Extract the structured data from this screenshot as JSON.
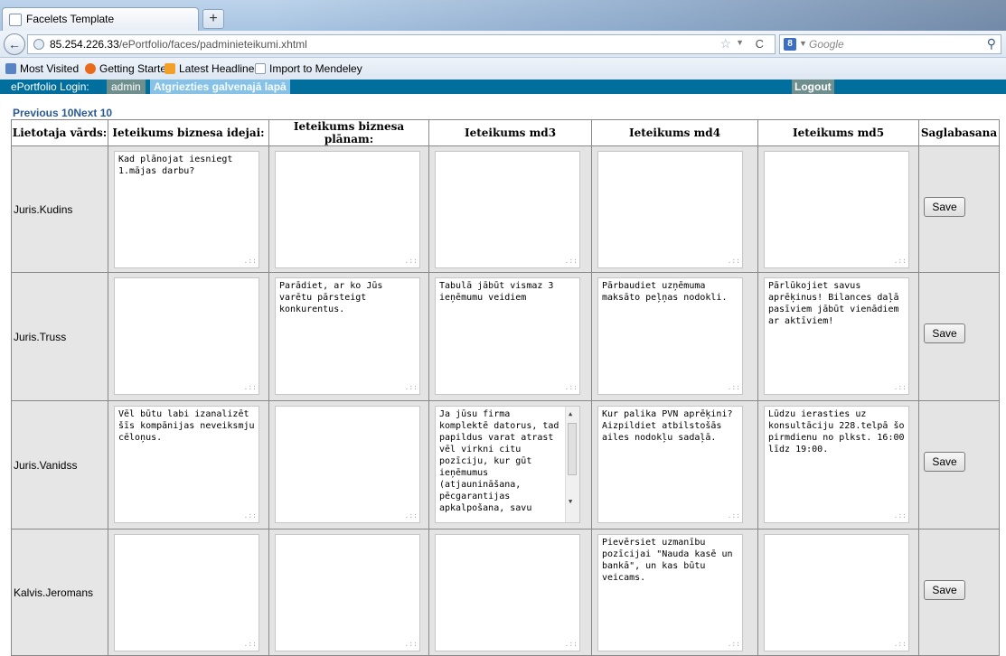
{
  "browser": {
    "tab_title": "Facelets Template",
    "new_tab": "+",
    "url_host": "85.254.226.33",
    "url_path": "/ePortfolio/faces/padminieteikumi.xhtml",
    "search_placeholder": "Google",
    "bookmarks": [
      {
        "label": "Most Visited",
        "icon": "bookmark-star-icon"
      },
      {
        "label": "Getting Started",
        "icon": "firefox-icon"
      },
      {
        "label": "Latest Headlines",
        "icon": "rss-icon"
      },
      {
        "label": "Import to Mendeley",
        "icon": "page-icon"
      }
    ]
  },
  "app": {
    "login_label": "ePortfolio Login:",
    "user": "admin",
    "back_link": "Atgriezties galvenajā lapā",
    "logout": "Logout",
    "prev": "Previous 10",
    "next": "Next 10"
  },
  "table": {
    "headers": [
      "Lietotaja vārds:",
      "Ieteikums biznesa idejai:",
      "Ieteikums biznesa plānam:",
      "Ieteikums md3",
      "Ieteikums md4",
      "Ieteikums md5",
      "Saglabasana"
    ],
    "save_label": "Save",
    "rows": [
      {
        "name": "Juris.Kudins",
        "cells": [
          "Kad plānojat iesniegt 1.mājas darbu?",
          "",
          "",
          "",
          ""
        ]
      },
      {
        "name": "Juris.Truss",
        "cells": [
          "",
          "Parādiet, ar ko Jūs varētu pārsteigt konkurentus.",
          "Tabulā jābūt vismaz 3 ieņēmumu veidiem",
          "Pārbaudiet uzņēmuma maksāto peļņas nodokli.",
          "Pārlūkojiet savus aprēķinus! Bilances daļā pasīviem jābūt vienādiem ar aktīviem!"
        ]
      },
      {
        "name": "Juris.Vanidss",
        "cells": [
          "Vēl būtu labi izanalizēt šīs kompānijas neveiksmju cēloņus.",
          "",
          "Ja jūsu firma komplektē datorus, tad papildus varat atrast vēl virkni citu pozīciju, kur gūt ieņēmumus (atjaunināšana, pēcgarantijas apkalpošana, savu",
          "Kur palika PVN aprēķini? Aizpildiet atbilstošās ailes nodokļu sadaļā.",
          "Lūdzu ierasties uz konsultāciju 228.telpā šo pirmdienu no plkst. 16:00 līdz 19:00."
        ]
      },
      {
        "name": "Kalvis.Jeromans",
        "cells": [
          "",
          "",
          "",
          "Pievērsiet uzmanību pozīcijai \"Nauda kasē un bankā\", un kas būtu veicams.",
          ""
        ]
      }
    ]
  }
}
